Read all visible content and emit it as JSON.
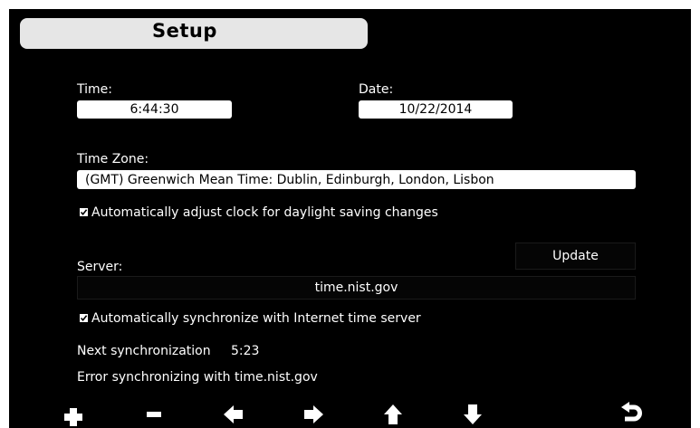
{
  "title": "Setup",
  "time": {
    "label": "Time:",
    "value": "6:44:30"
  },
  "date": {
    "label": "Date:",
    "value": "10/22/2014"
  },
  "timezone": {
    "label": "Time Zone:",
    "value": "(GMT) Greenwich Mean Time: Dublin, Edinburgh, London, Lisbon"
  },
  "dst_checkbox": {
    "label": "Automatically adjust clock for daylight saving changes",
    "checked": true
  },
  "update_button": "Update",
  "server": {
    "label": "Server:",
    "value": "time.nist.gov"
  },
  "sync_checkbox": {
    "label": "Automatically synchronize with Internet time server",
    "checked": true
  },
  "next_sync": {
    "label": "Next synchronization",
    "value": "5:23"
  },
  "status_message": "Error synchronizing with time.nist.gov",
  "toolbar": {
    "icons": [
      "plus-icon",
      "minus-icon",
      "arrow-left-icon",
      "arrow-right-icon",
      "arrow-up-icon",
      "arrow-down-icon",
      "return-icon"
    ]
  },
  "colors": {
    "background": "#000000",
    "title_bar": "#e6e6e6",
    "field": "#ffffff",
    "text": "#ffffff"
  }
}
